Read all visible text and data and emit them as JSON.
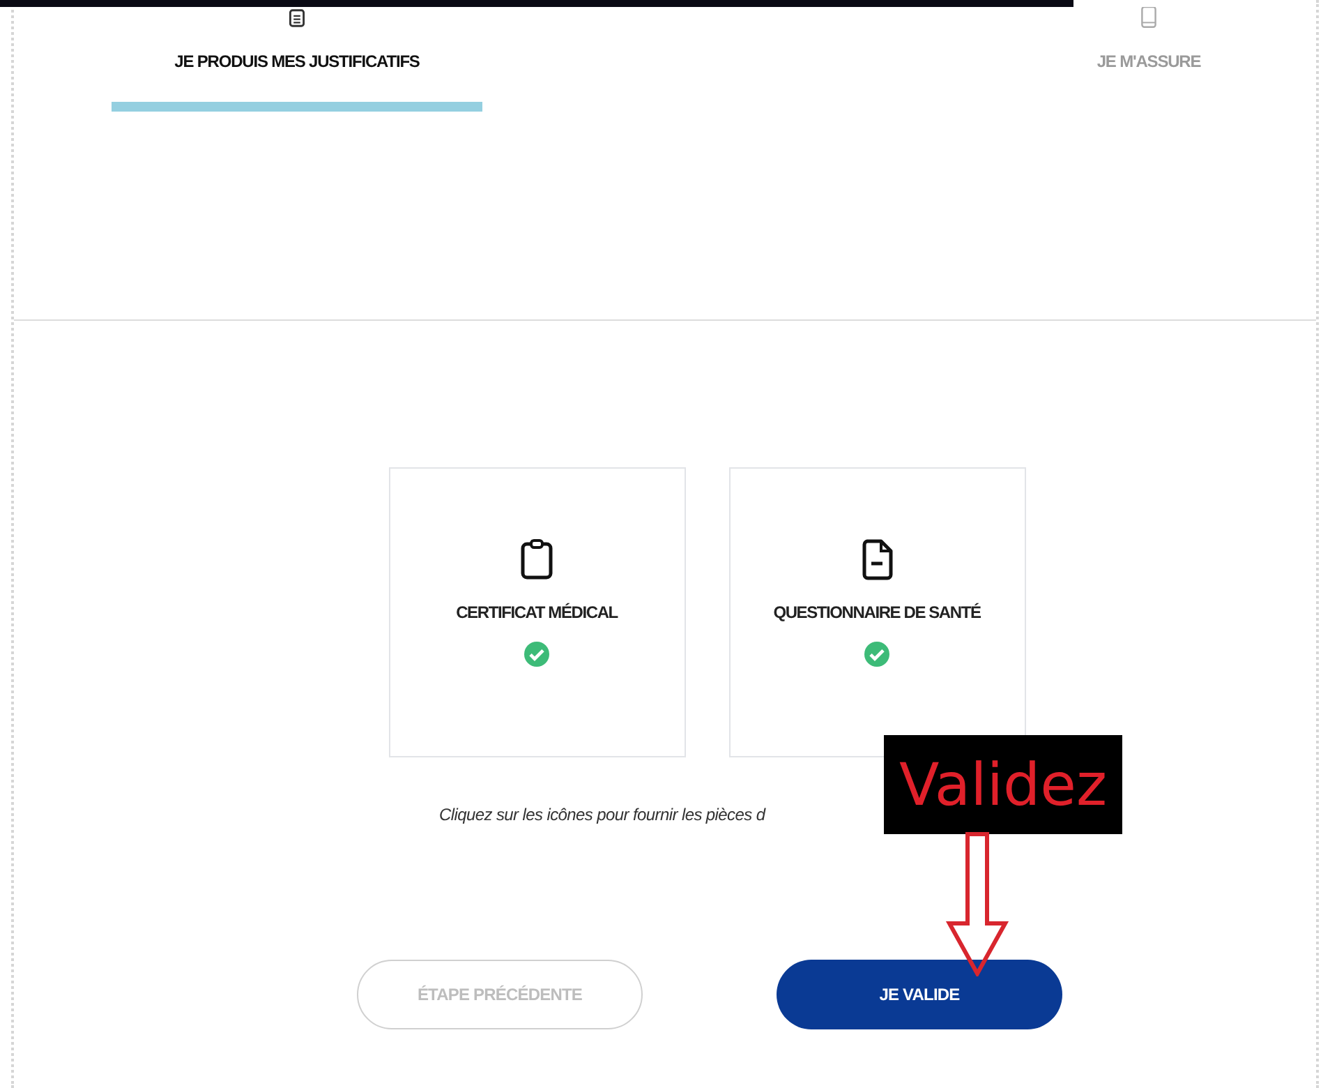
{
  "tabs": [
    {
      "label": "JE PRODUIS MES JUSTIFICATIFS",
      "selected": true
    },
    {
      "label": "JE M'ASSURE",
      "selected": false
    }
  ],
  "documents": [
    {
      "kind": "clipboard",
      "label": "CERTIFICAT MÉDICAL",
      "checked": true
    },
    {
      "kind": "file",
      "label": "QUESTIONNAIRE DE SANTÉ",
      "checked": true
    }
  ],
  "caption": "Cliquez sur les icônes pour fournir les pièces d",
  "buttons": [
    {
      "label": "ÉTAPE PRÉCÉDENTE",
      "kind": "secondary"
    },
    {
      "label": "JE VALIDE",
      "kind": "primary"
    }
  ],
  "annotation": {
    "label": "Validez"
  }
}
